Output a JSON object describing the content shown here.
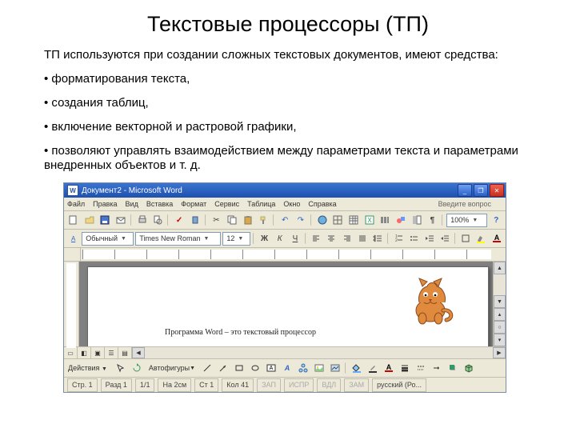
{
  "slide": {
    "title": "Текстовые процессоры (ТП)",
    "lead": "ТП используются при создании сложных текстовых документов, имеют средства:",
    "bullets": [
      "• форматирования текста,",
      "• создания таблиц,",
      "• включение векторной и растровой графики,",
      "• позволяют управлять взаимодействием между параметрами текста и параметрами внедренных объектов и т. д."
    ]
  },
  "word": {
    "titlebar": {
      "title": "Документ2 - Microsoft Word",
      "app_letter": "W",
      "min": "_",
      "max": "❐",
      "close": "✕"
    },
    "menu": {
      "items": [
        "Файл",
        "Правка",
        "Вид",
        "Вставка",
        "Формат",
        "Сервис",
        "Таблица",
        "Окно",
        "Справка"
      ],
      "question_hint": "Введите вопрос"
    },
    "toolbar1": {
      "zoom": "100%"
    },
    "toolbar2": {
      "style": "Обычный",
      "font": "Times New Roman",
      "size": "12"
    },
    "document_text": "Программа Word – это текстовый процессор",
    "drawbar": {
      "actions": "Действия",
      "autoshapes": "Автофигуры"
    },
    "status": {
      "page": "Стр. 1",
      "section": "Разд 1",
      "pages": "1/1",
      "at": "На 2см",
      "line": "Ст 1",
      "col": "Кол 41",
      "rec": "ЗАП",
      "trk": "ИСПР",
      "ext": "ВДЛ",
      "ovr": "ЗАМ",
      "lang": "русский (Ро..."
    }
  }
}
